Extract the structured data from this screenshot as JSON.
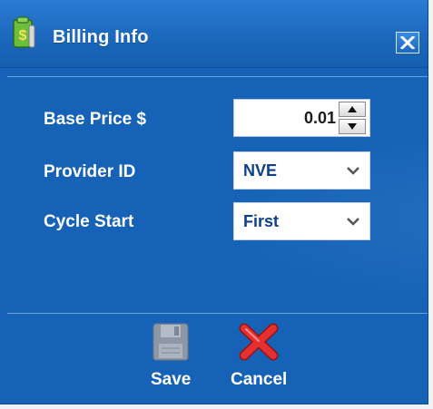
{
  "window": {
    "title": "Billing Info",
    "icons": {
      "title": "money-bag-icon",
      "close": "close-icon"
    }
  },
  "form": {
    "base_price": {
      "label": "Base Price $",
      "value": "0.01"
    },
    "provider_id": {
      "label": "Provider ID",
      "selected": "NVE"
    },
    "cycle_start": {
      "label": "Cycle Start",
      "selected": "First"
    }
  },
  "actions": {
    "save": {
      "label": "Save",
      "icon": "floppy-disk-icon",
      "enabled": false
    },
    "cancel": {
      "label": "Cancel",
      "icon": "red-x-icon"
    }
  },
  "colors": {
    "window_blue": "#1562b6",
    "title_text": "#ffffff",
    "select_text": "#0e3f8a",
    "cancel_red": "#e53030"
  }
}
